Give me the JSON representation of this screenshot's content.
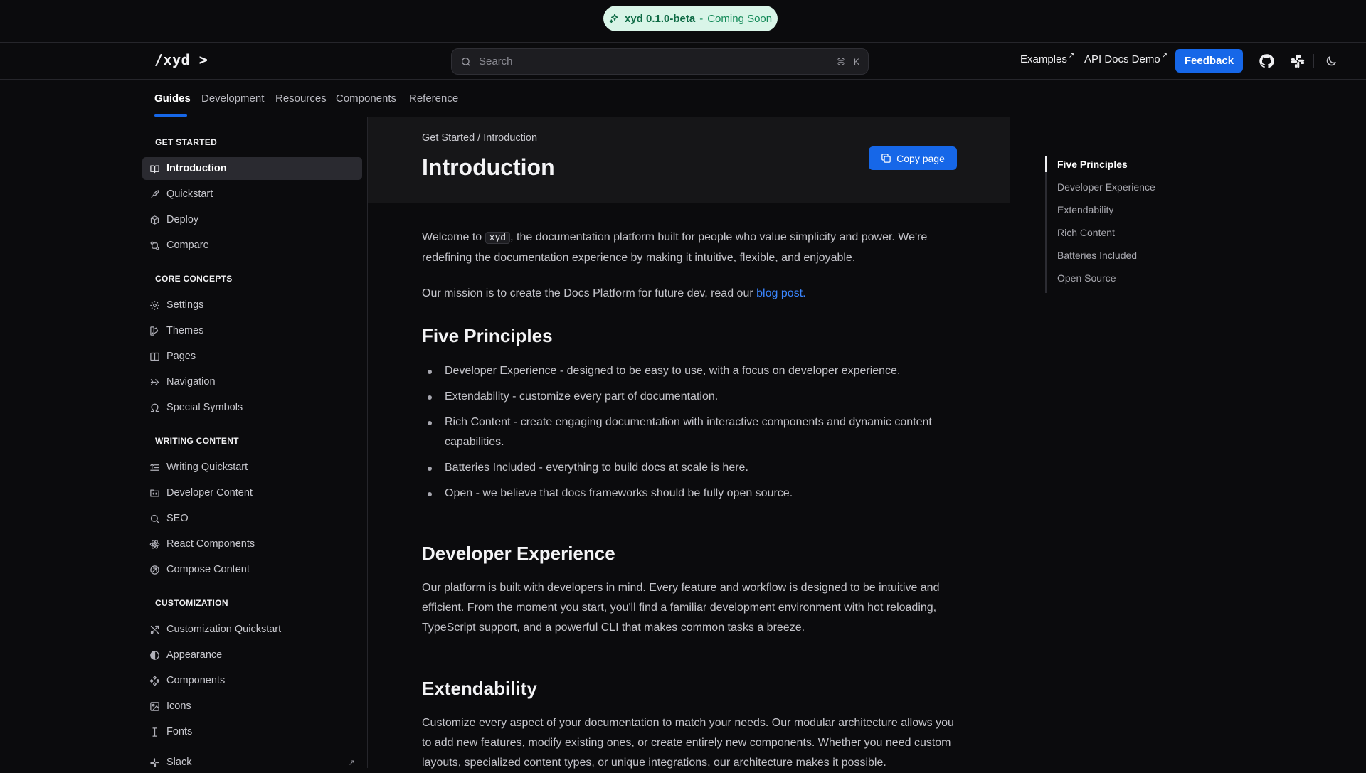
{
  "banner": {
    "version": "xyd 0.1.0-beta",
    "separator": " - ",
    "status": "Coming Soon"
  },
  "header": {
    "logo": "/xyd >",
    "search": {
      "placeholder": "Search",
      "shortcut_symbol": "⌘",
      "shortcut_key": "K"
    },
    "links": [
      {
        "label": "Examples",
        "external": "↗"
      },
      {
        "label": "API Docs Demo",
        "external": "↗"
      }
    ],
    "feedback_label": "Feedback",
    "icons": [
      "github-icon",
      "slack-icon",
      "moon-icon"
    ]
  },
  "tabs": [
    {
      "label": "Guides",
      "active": true
    },
    {
      "label": "Development"
    },
    {
      "label": "Resources"
    },
    {
      "label": "Components"
    },
    {
      "label": "Reference"
    }
  ],
  "sidebar": {
    "sections": [
      {
        "title": "GET STARTED",
        "items": [
          {
            "label": "Introduction",
            "icon": "book-icon",
            "active": true
          },
          {
            "label": "Quickstart",
            "icon": "rocket-icon"
          },
          {
            "label": "Deploy",
            "icon": "package-icon"
          },
          {
            "label": "Compare",
            "icon": "compare-icon"
          }
        ]
      },
      {
        "title": "CORE CONCEPTS",
        "items": [
          {
            "label": "Settings",
            "icon": "gear-icon"
          },
          {
            "label": "Themes",
            "icon": "palette-icon"
          },
          {
            "label": "Pages",
            "icon": "pages-icon"
          },
          {
            "label": "Navigation",
            "icon": "navigation-icon"
          },
          {
            "label": "Special Symbols",
            "icon": "omega-icon"
          }
        ]
      },
      {
        "title": "WRITING CONTENT",
        "items": [
          {
            "label": "Writing Quickstart",
            "icon": "text-icon"
          },
          {
            "label": "Developer Content",
            "icon": "folder-code-icon"
          },
          {
            "label": "SEO",
            "icon": "search-icon"
          },
          {
            "label": "React Components",
            "icon": "atom-icon"
          },
          {
            "label": "Compose Content",
            "icon": "compose-icon"
          }
        ]
      },
      {
        "title": "CUSTOMIZATION",
        "items": [
          {
            "label": "Customization Quickstart",
            "icon": "tools-icon"
          },
          {
            "label": "Appearance",
            "icon": "contrast-icon"
          },
          {
            "label": "Components",
            "icon": "components-icon"
          },
          {
            "label": "Icons",
            "icon": "image-icon"
          },
          {
            "label": "Fonts",
            "icon": "text-cursor-icon"
          }
        ]
      }
    ],
    "footer_link": {
      "label": "Slack",
      "external": "↗"
    }
  },
  "page": {
    "breadcrumb": "Get Started / Introduction",
    "title": "Introduction",
    "copy_label": "Copy page",
    "intro_before_code": "Welcome to ",
    "intro_code": "xyd",
    "intro_after_code": ", the documentation platform built for people who value simplicity and power. We're redefining the documentation experience by making it intuitive, flexible, and enjoyable.",
    "mission_text": "Our mission is to create the Docs Platform for future dev, read our ",
    "mission_link": "blog post.",
    "principles_heading": "Five Principles",
    "principles": [
      "Developer Experience - designed to be easy to use, with a focus on developer experience.",
      "Extendability - customize every part of documentation.",
      "Rich Content - create engaging documentation with interactive components and dynamic content capabilities.",
      "Batteries Included - everything to build docs at scale is here.",
      "Open - we believe that docs frameworks should be fully open source."
    ],
    "devx_heading": "Developer Experience",
    "devx_text": "Our platform is built with developers in mind. Every feature and workflow is designed to be intuitive and efficient. From the moment you start, you'll find a familiar development environment with hot reloading, TypeScript support, and a powerful CLI that makes common tasks a breeze.",
    "ext_heading": "Extendability",
    "ext_text": "Customize every aspect of your documentation to match your needs. Our modular architecture allows you to add new features, modify existing ones, or create entirely new components. Whether you need custom layouts, specialized content types, or unique integrations, our architecture makes it possible."
  },
  "toc": [
    {
      "label": "Five Principles",
      "active": true
    },
    {
      "label": "Developer Experience"
    },
    {
      "label": "Extendability"
    },
    {
      "label": "Rich Content"
    },
    {
      "label": "Batteries Included"
    },
    {
      "label": "Open Source"
    }
  ]
}
